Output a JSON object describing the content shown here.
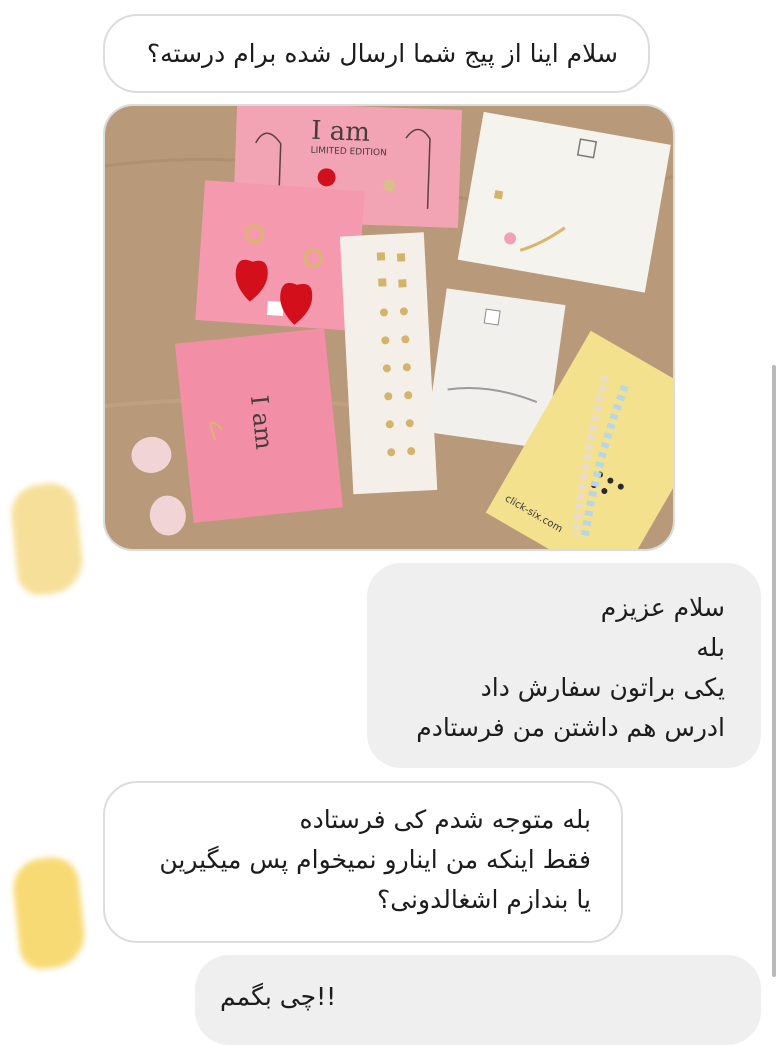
{
  "thread": {
    "messages": [
      {
        "side": "received",
        "lines": [
          "سلام اینا از پیج شما ارسال شده برام درسته؟"
        ]
      },
      {
        "side": "received",
        "kind": "photo",
        "card_texts": {
          "brand_card": "I am",
          "edition": "LIMITED EDITION",
          "site": "click-six.com"
        }
      },
      {
        "side": "sent",
        "lines": [
          "سلام عزیزم",
          "بله",
          "یکی براتون سفارش داد",
          "ادرس هم داشتن من فرستادم"
        ]
      },
      {
        "side": "received",
        "lines": [
          "بله متوجه شدم کی فرستاده",
          "فقط اینکه من اینارو نمیخوام پس میگیرین",
          "یا بندازم اشغالدونی؟"
        ]
      },
      {
        "side": "sent",
        "lines": [
          "چی بگمم!!"
        ]
      }
    ]
  },
  "colors": {
    "sent_bubble": "#efefef",
    "received_bubble_border": "#dcdcdc",
    "avatar_1": "#f6dc8e",
    "avatar_2": "#f8d666"
  },
  "icons": [
    "avatar"
  ]
}
